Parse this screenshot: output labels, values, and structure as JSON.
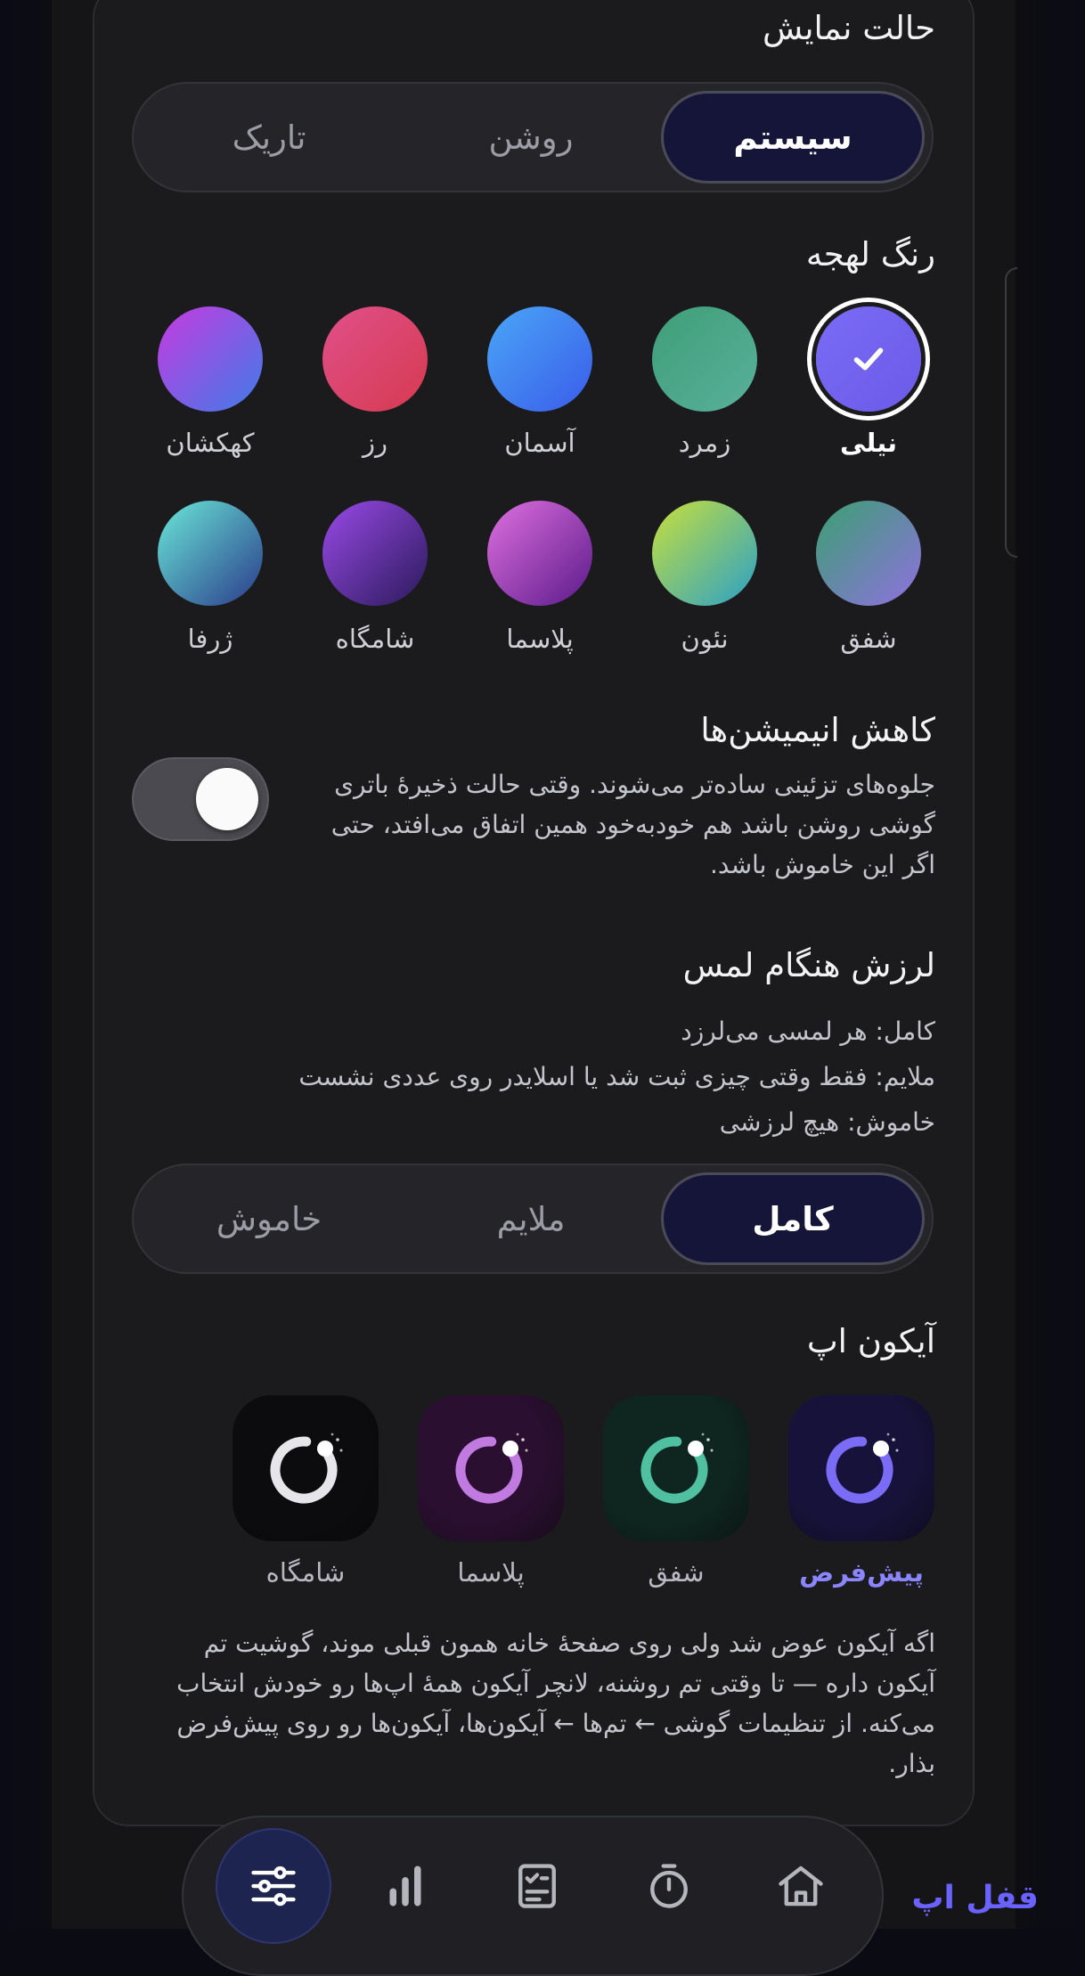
{
  "display_mode": {
    "title": "حالت نمایش",
    "options": [
      "سیستم",
      "روشن",
      "تاریک"
    ],
    "selected": "سیستم"
  },
  "accent": {
    "title": "رنگ لهجه",
    "selected": "نیلی",
    "colors": [
      {
        "label": "نیلی",
        "from": "#7b6cf6",
        "to": "#6a5ae8"
      },
      {
        "label": "زمرد",
        "from": "#3f9e78",
        "to": "#58b09a"
      },
      {
        "label": "آسمان",
        "from": "#4aa6f7",
        "to": "#3a5cea"
      },
      {
        "label": "رز",
        "from": "#e0508a",
        "to": "#d63a50"
      },
      {
        "label": "کهکشان",
        "from": "#c63ae0",
        "to": "#3f7ce8"
      },
      {
        "label": "شفق",
        "from": "#3aa070",
        "to": "#9070e0"
      },
      {
        "label": "نئون",
        "from": "#c8e03a",
        "to": "#2aa0c8"
      },
      {
        "label": "پلاسما",
        "from": "#e070e0",
        "to": "#5a1a8a"
      },
      {
        "label": "شامگاه",
        "from": "#9a4ae8",
        "to": "#2a1a5a"
      },
      {
        "label": "ژرفا",
        "from": "#6ae8d8",
        "to": "#2a3a8a"
      }
    ]
  },
  "reduce_motion": {
    "title": "کاهش انیمیشن‌ها",
    "lines": [
      "جلوه‌های تزئینی ساده‌تر می‌شوند. وقتی حالت ذخیرهٔ باتری",
      "گوشی روشن باشد هم خودبه‌خود همین اتفاق می‌افتد، حتی",
      "اگر این خاموش باشد."
    ],
    "enabled": true
  },
  "haptics": {
    "title": "لرزش هنگام لمس",
    "lines": [
      "کامل: هر لمسی می‌لرزد",
      "ملایم: فقط وقتی چیزی ثبت شد یا اسلایدر روی عددی نشست",
      "خاموش: هیچ لرزشی"
    ],
    "options": [
      "کامل",
      "ملایم",
      "خاموش"
    ],
    "selected": "کامل"
  },
  "app_icon": {
    "title": "آیکون اپ",
    "selected": "پیش‌فرض",
    "icons": [
      {
        "label": "پیش‌فرض",
        "bg": "#17123a",
        "ring": "#7b6cf6"
      },
      {
        "label": "شفق",
        "bg": "#0f2620",
        "ring": "#4fc0a0"
      },
      {
        "label": "پلاسما",
        "bg": "#2a0f30",
        "ring": "#c07ae0"
      },
      {
        "label": "شامگاه",
        "bg": "#0c0c0e",
        "ring": "#e6e6ea"
      }
    ],
    "note_lines": [
      "اگه آیکون عوض شد ولی روی صفحهٔ خانه همون قبلی موند، گوشیت تم",
      "آیکون داره — تا وقتی تم روشنه، لانچر آیکون همهٔ اپ‌ها رو خودش انتخاب",
      "می‌کنه. از تنظیمات گوشی ← تم‌ها ← آیکون‌ها، آیکون‌ها رو روی پیش‌فرض",
      "بذار."
    ]
  },
  "bottom_nav": {
    "items": [
      "home-icon",
      "timer-icon",
      "checklist-icon",
      "stats-icon",
      "settings-sliders-icon"
    ],
    "active": "settings-sliders-icon"
  },
  "app_lock_link": "قفل اپ",
  "colors": {
    "accent": "#7b6cf6",
    "segment_active_bg": "#15153a",
    "nav_active_bg": "#1e2450"
  }
}
